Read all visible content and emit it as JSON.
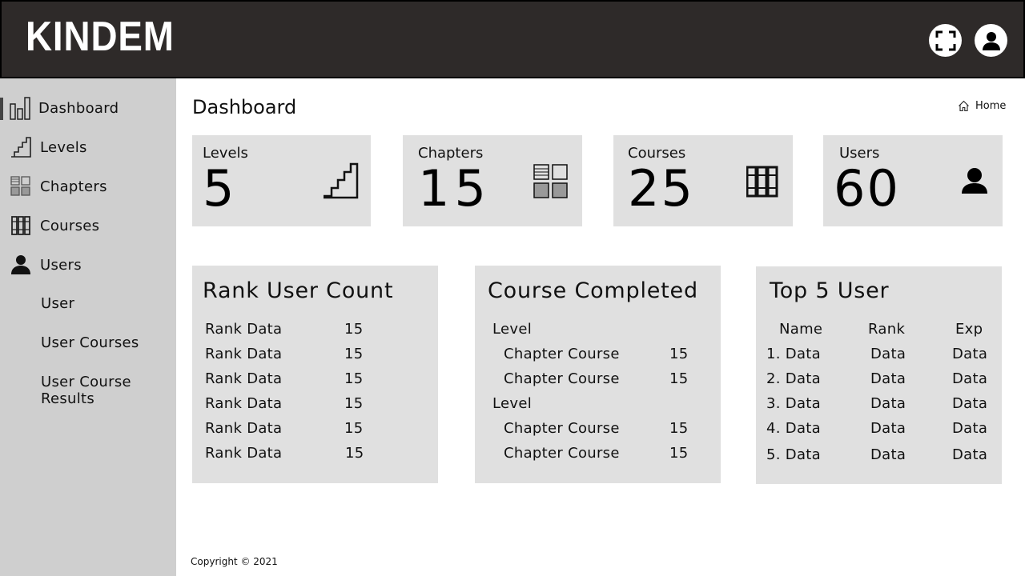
{
  "header": {
    "brand": "KINDEM",
    "fullscreen_icon": "fullscreen-icon",
    "profile_icon": "user-avatar-icon"
  },
  "sidebar": {
    "items": [
      {
        "label": "Dashboard",
        "icon": "dashboard-bars-icon",
        "active": true
      },
      {
        "label": "Levels",
        "icon": "stairs-icon"
      },
      {
        "label": "Chapters",
        "icon": "grid-icon"
      },
      {
        "label": "Courses",
        "icon": "books-icon"
      },
      {
        "label": "Users",
        "icon": "person-icon"
      }
    ],
    "sub_items": [
      "User",
      "User Courses",
      "User Course Results"
    ]
  },
  "page": {
    "title": "Dashboard",
    "breadcrumb": "Home",
    "breadcrumb_icon": "home-icon"
  },
  "stats": [
    {
      "title": "Levels",
      "value": "5",
      "icon": "stairs-icon"
    },
    {
      "title": "Chapters",
      "value": "15",
      "icon": "grid-icon"
    },
    {
      "title": "Courses",
      "value": "25",
      "icon": "books-icon"
    },
    {
      "title": "Users",
      "value": "60",
      "icon": "person-icon"
    }
  ],
  "rank_panel": {
    "title": "Rank User Count",
    "rows": [
      {
        "label": "Rank Data",
        "value": "15"
      },
      {
        "label": "Rank Data",
        "value": "15"
      },
      {
        "label": "Rank Data",
        "value": "15"
      },
      {
        "label": "Rank Data",
        "value": "15"
      },
      {
        "label": "Rank Data",
        "value": "15"
      },
      {
        "label": "Rank Data",
        "value": "15"
      }
    ]
  },
  "course_panel": {
    "title": "Course Completed",
    "rows": [
      {
        "label": "Level",
        "value": ""
      },
      {
        "label": "Chapter Course",
        "value": "15"
      },
      {
        "label": "Chapter Course",
        "value": "15"
      },
      {
        "label": "Level",
        "value": ""
      },
      {
        "label": "Chapter Course",
        "value": "15"
      },
      {
        "label": "Chapter Course",
        "value": "15"
      }
    ]
  },
  "top_panel": {
    "title": "Top 5 User",
    "headers": [
      "Name",
      "Rank",
      "Exp"
    ],
    "rows": [
      [
        "1. Data",
        "Data",
        "Data"
      ],
      [
        "2. Data",
        "Data",
        "Data"
      ],
      [
        "3. Data",
        "Data",
        "Data"
      ],
      [
        "4. Data",
        "Data",
        "Data"
      ],
      [
        "5. Data",
        "Data",
        "Data"
      ]
    ]
  },
  "footer": {
    "text": "Copyright © 2021"
  },
  "colors": {
    "header_bg": "#2e2a29",
    "sidebar_bg": "#cfcfcf",
    "card_bg": "#e0e0e0"
  }
}
